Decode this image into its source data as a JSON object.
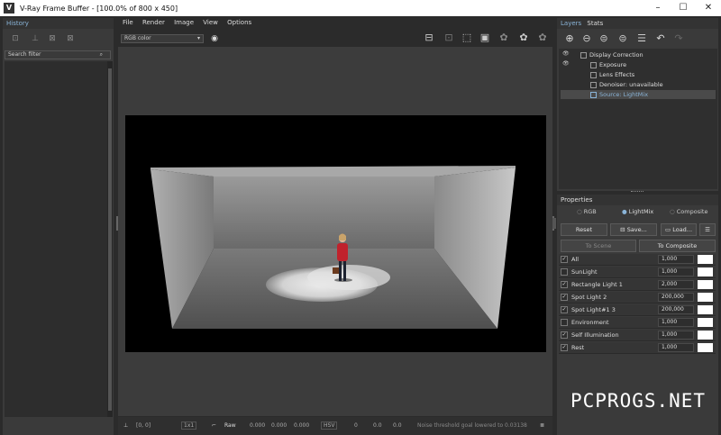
{
  "window": {
    "app_icon": "V",
    "title": "V-Ray Frame Buffer - [100.0% of 800 x 450]",
    "minimize": "–",
    "maximize": "☐",
    "close": "✕"
  },
  "history": {
    "header": "History",
    "search_placeholder": "Search filter"
  },
  "menu": [
    "File",
    "Render",
    "Image",
    "View",
    "Options"
  ],
  "toolbar": {
    "channel": "RGB color"
  },
  "right_tabs": [
    "Layers",
    "Stats"
  ],
  "layers": [
    {
      "label": "Display Correction",
      "visible": true
    },
    {
      "label": "Exposure",
      "visible": true
    },
    {
      "label": "Lens Effects",
      "visible": false
    },
    {
      "label": "Denoiser: unavailable",
      "visible": false
    },
    {
      "label": "Source: LightMix",
      "visible": true,
      "selected": true
    }
  ],
  "properties": {
    "header": "Properties",
    "modes": [
      {
        "label": "RGB",
        "selected": false
      },
      {
        "label": "LightMix",
        "selected": true
      },
      {
        "label": "Composite",
        "selected": false
      }
    ],
    "reset": "Reset",
    "save": "Save...",
    "load": "Load...",
    "to_scene": "To Scene",
    "to_composite": "To Composite"
  },
  "lightmix": [
    {
      "name": "All",
      "value": "1,000",
      "checked": true
    },
    {
      "name": "SunLight",
      "value": "1,000",
      "checked": false
    },
    {
      "name": "Rectangle Light 1",
      "value": "2,000",
      "checked": true
    },
    {
      "name": "Spot Light 2",
      "value": "200,000",
      "checked": true
    },
    {
      "name": "Spot Light#1 3",
      "value": "200,000",
      "checked": true
    },
    {
      "name": "Environment",
      "value": "1,000",
      "checked": false
    },
    {
      "name": "Self Illumination",
      "value": "1,000",
      "checked": true
    },
    {
      "name": "Rest",
      "value": "1,000",
      "checked": true
    }
  ],
  "status": {
    "coords": "[0, 0]",
    "zoom": "1x1",
    "raw": "Raw",
    "r": "0.000",
    "g": "0.000",
    "b": "0.000",
    "mode": "HSV",
    "h": "0",
    "s": "0.0",
    "v": "0.0",
    "message": "Noise threshold goal lowered to 0.03138"
  },
  "watermark": "PCPROGS.NET"
}
